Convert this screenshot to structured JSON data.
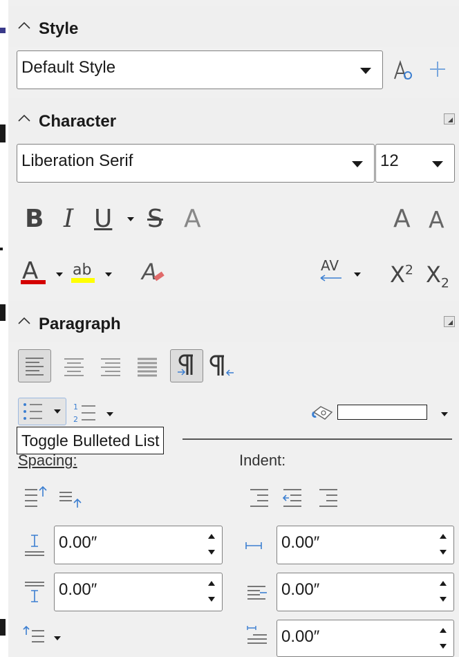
{
  "sections": {
    "style": {
      "title": "Style"
    },
    "character": {
      "title": "Character"
    },
    "paragraph": {
      "title": "Paragraph"
    }
  },
  "style": {
    "value": "Default Style"
  },
  "character": {
    "font_name": "Liberation Serif",
    "font_size": "12",
    "bold_label": "B",
    "italic_label": "I",
    "underline_label": "U",
    "strike_label": "S",
    "shadow_label": "A",
    "grow_label": "A",
    "shrink_label": "A",
    "fontcolor_label": "A",
    "highlight_label": "ab",
    "clearfmt_label": "A",
    "spacing_label": "AV",
    "superscript_label": "X",
    "superscript_exp": "2",
    "subscript_label": "X",
    "subscript_exp": "2"
  },
  "colors": {
    "font_color": "#d40000",
    "highlight_color": "#ffff00",
    "accent": "#3c7fd1"
  },
  "paragraph": {
    "tooltip": "Toggle Bulleted List",
    "spacing_label": "Spacing:",
    "indent_label": "Indent:",
    "above_spacing": "0.00″",
    "below_spacing": "0.00″",
    "before_indent": "0.00″",
    "after_indent": "0.00″",
    "first_line_indent": "0.00″"
  }
}
